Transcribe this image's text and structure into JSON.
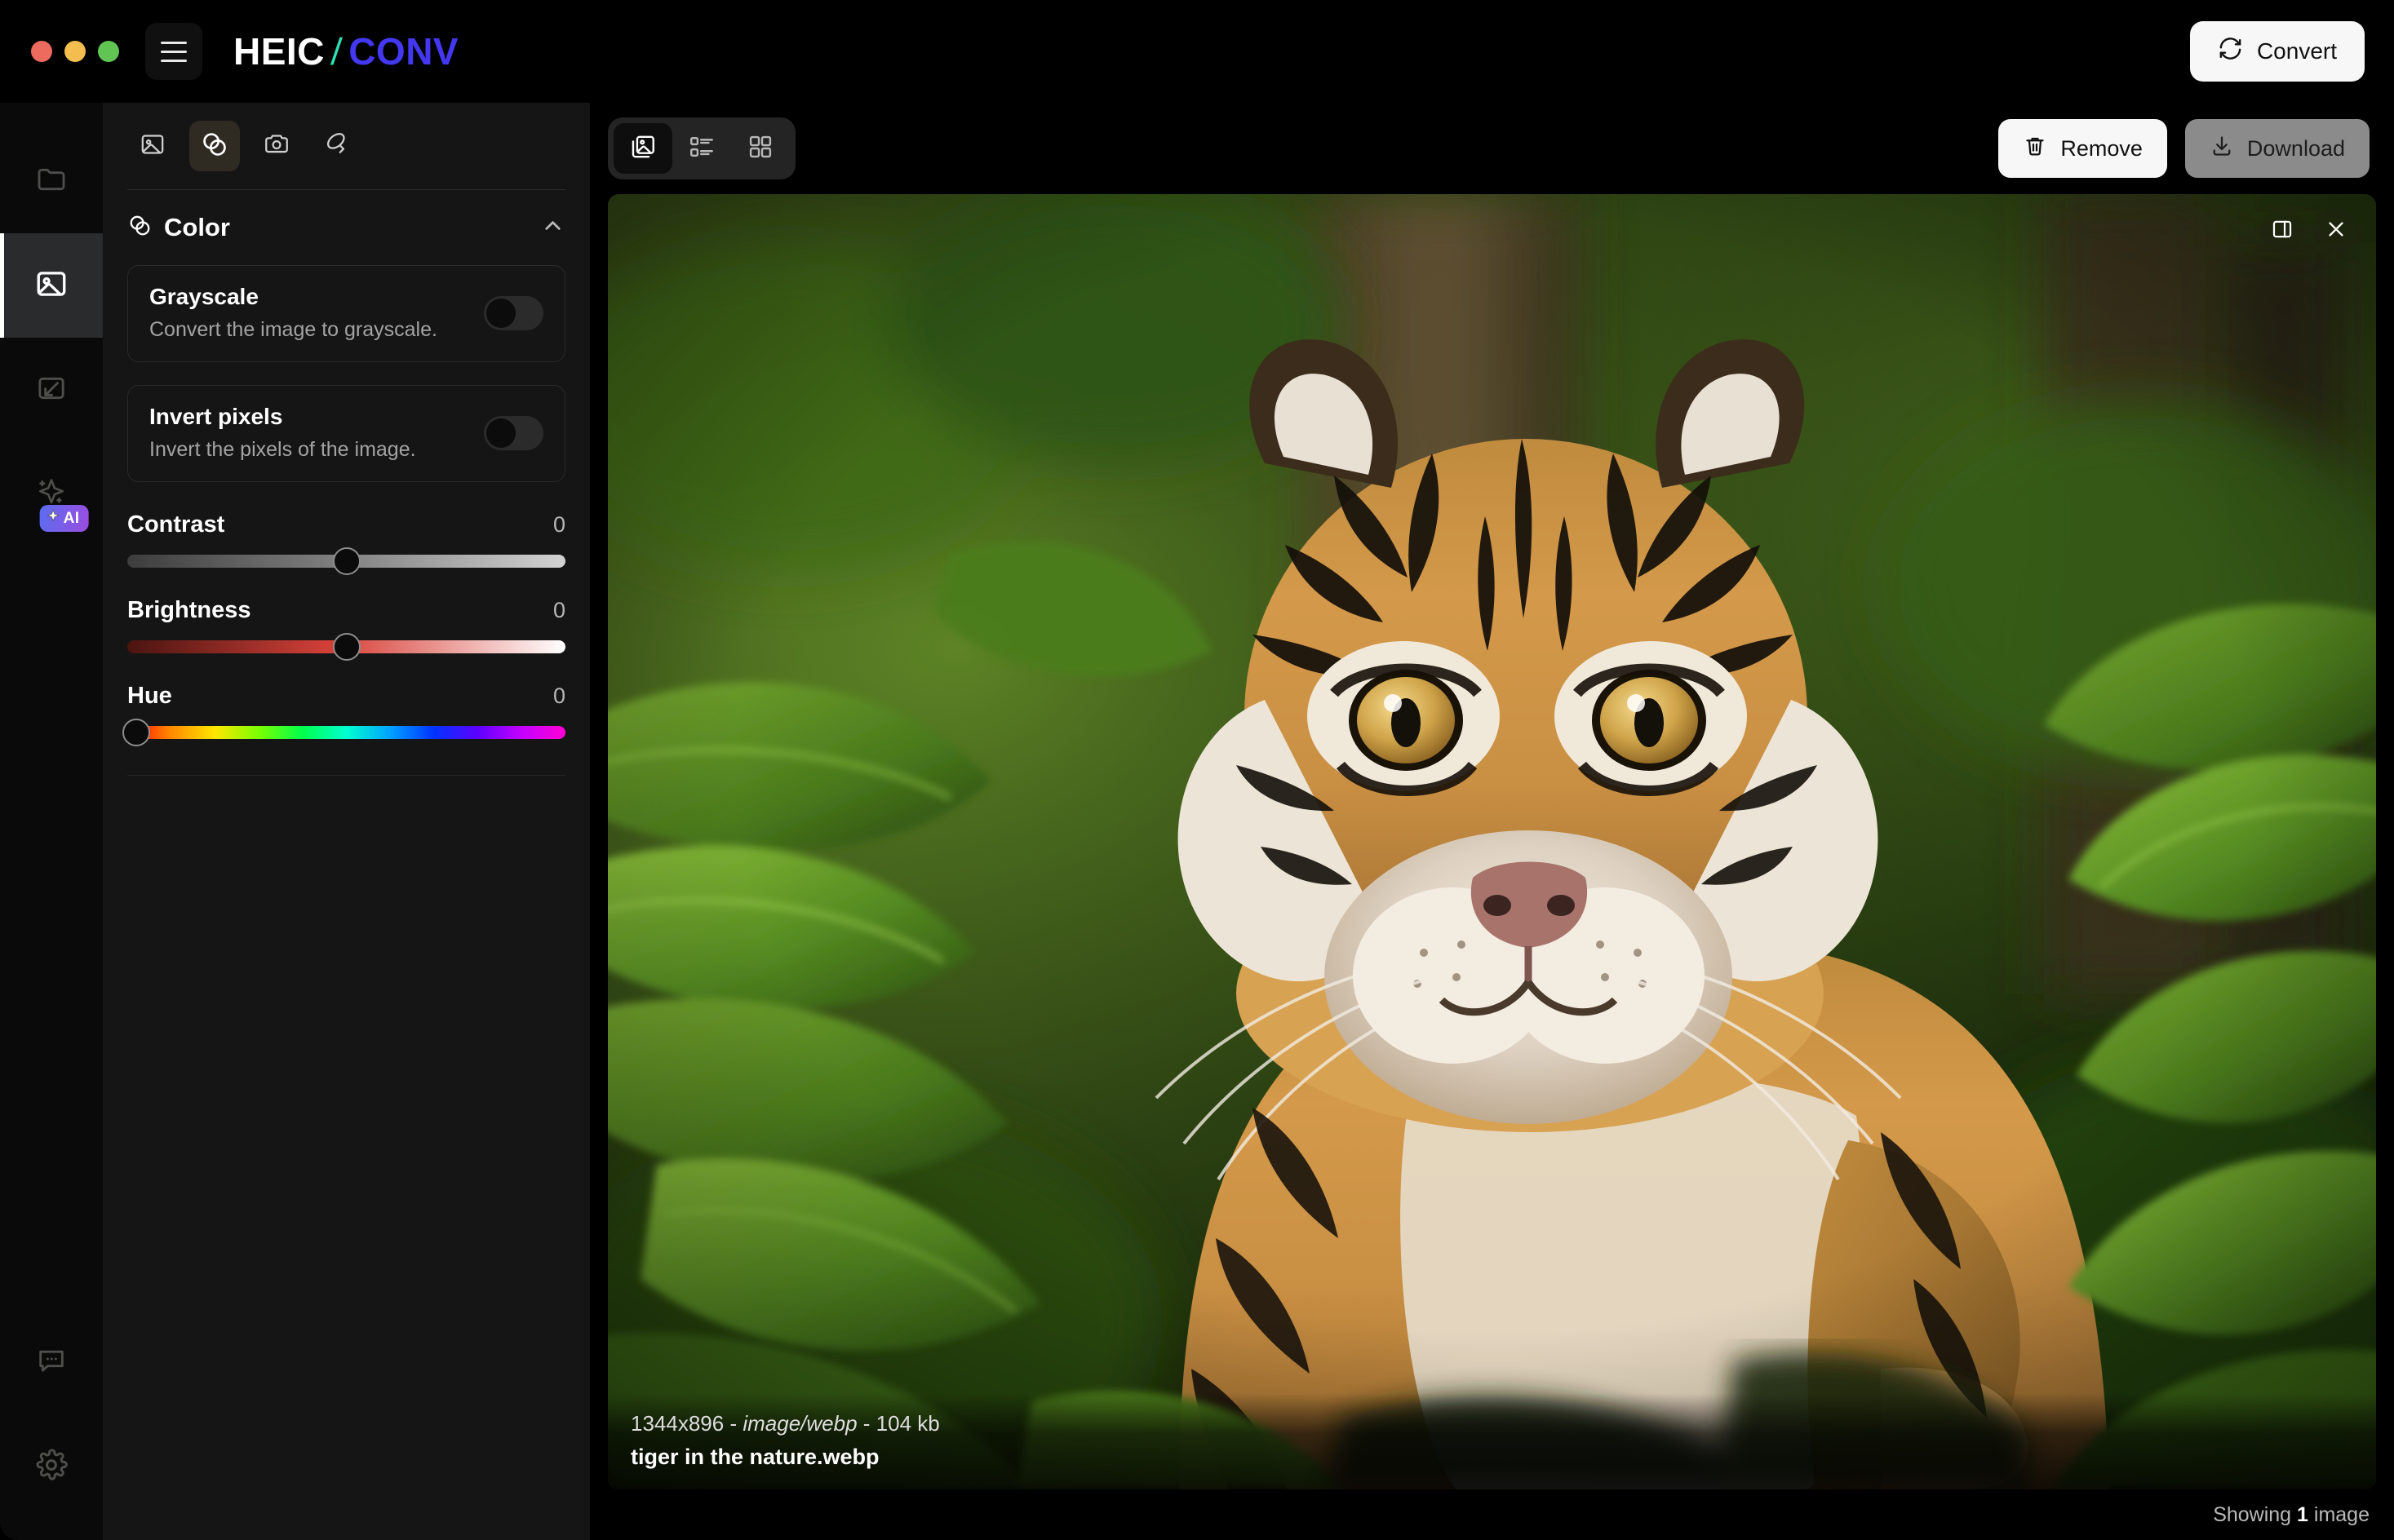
{
  "window": {
    "traffic_lights": [
      "close",
      "minimize",
      "maximize"
    ],
    "colors": {
      "close": "#ed6a5e",
      "minimize": "#f4bd4f",
      "maximize": "#61c554"
    }
  },
  "header": {
    "menu_icon": "hamburger-icon",
    "brand_part1": "HEIC",
    "brand_separator": "/",
    "brand_part2": "CONV",
    "brand_colors": {
      "part1": "#ffffff",
      "separator": "#2ee0b0",
      "part2": "#4338f0"
    },
    "convert_label": "Convert",
    "convert_icon": "refresh-icon"
  },
  "rail": {
    "items": [
      {
        "name": "folder",
        "icon": "folder-icon",
        "active": false
      },
      {
        "name": "images",
        "icon": "image-icon",
        "active": true
      },
      {
        "name": "resize",
        "icon": "resize-arrow-icon",
        "active": false
      },
      {
        "name": "ai-tools",
        "icon": "sparkle-icon",
        "active": false,
        "badge": "AI",
        "badge_icon": "sparkle-small-icon"
      }
    ],
    "bottom_items": [
      {
        "name": "feedback",
        "icon": "chat-bubble-icon"
      },
      {
        "name": "settings",
        "icon": "gear-icon"
      }
    ]
  },
  "panel": {
    "tools": [
      {
        "name": "image",
        "icon": "image-icon",
        "active": false
      },
      {
        "name": "color",
        "icon": "blend-circles-icon",
        "active": true
      },
      {
        "name": "camera",
        "icon": "camera-icon",
        "active": false
      },
      {
        "name": "rotate",
        "icon": "rotate-3d-icon",
        "active": false
      }
    ],
    "section": {
      "title": "Color",
      "icon": "blend-circles-icon",
      "collapse_icon": "chevron-up-icon",
      "expanded": true
    },
    "options": [
      {
        "title": "Grayscale",
        "description": "Convert the image to grayscale.",
        "enabled": false
      },
      {
        "title": "Invert pixels",
        "description": "Invert the pixels of the image.",
        "enabled": false
      }
    ],
    "sliders": [
      {
        "label": "Contrast",
        "value": "0",
        "percent": 50,
        "track": "contrast"
      },
      {
        "label": "Brightness",
        "value": "0",
        "percent": 50,
        "track": "brightness"
      },
      {
        "label": "Hue",
        "value": "0",
        "percent": 2,
        "track": "hue"
      }
    ]
  },
  "main": {
    "views": [
      {
        "name": "single",
        "icon": "single-image-icon",
        "active": true
      },
      {
        "name": "list",
        "icon": "list-view-icon",
        "active": false
      },
      {
        "name": "grid",
        "icon": "grid-view-icon",
        "active": false
      }
    ],
    "remove_label": "Remove",
    "remove_icon": "trash-icon",
    "download_label": "Download",
    "download_icon": "download-icon",
    "overlay_icons": [
      {
        "name": "compare-panel",
        "icon": "panel-split-icon"
      },
      {
        "name": "close-preview",
        "icon": "close-icon"
      }
    ],
    "image": {
      "dimensions": "1344x896",
      "separator1": " - ",
      "mime": "image/webp",
      "separator2": " - ",
      "size": "104 kb",
      "filename": "tiger in the nature.webp",
      "alt": "tiger walking through green jungle foliage"
    },
    "status_prefix": "Showing ",
    "status_count": "1",
    "status_suffix": " image"
  }
}
